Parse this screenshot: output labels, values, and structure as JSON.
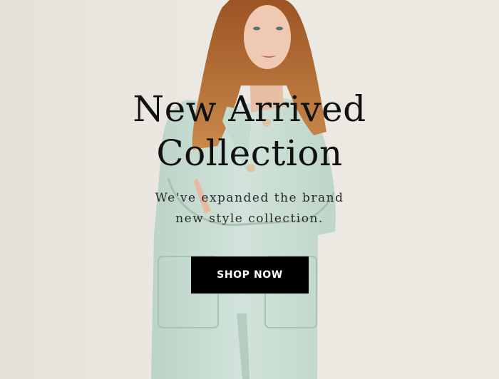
{
  "hero": {
    "title_line1": "New Arrived",
    "title_line2": "Collection",
    "subtitle_line1": "We've expanded the brand",
    "subtitle_line2": "new style collection.",
    "cta_label": "SHOP NOW"
  },
  "colors": {
    "background": "#e8e4de",
    "coat": "#c9ddd3",
    "hair": "#b86b2e",
    "button": "#000000",
    "button_text": "#ffffff",
    "headline": "#111111"
  }
}
